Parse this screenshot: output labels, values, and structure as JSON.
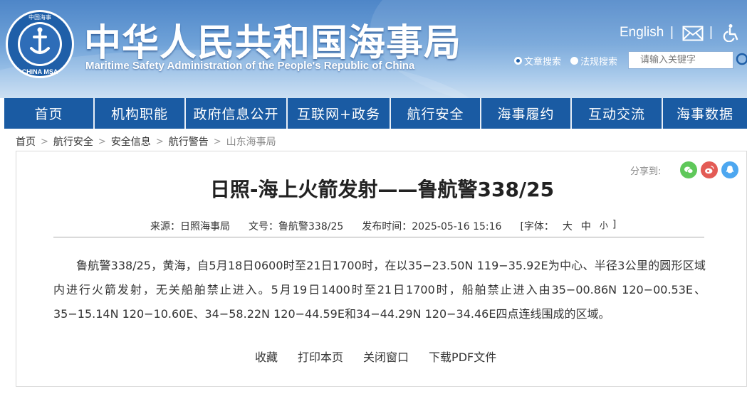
{
  "header": {
    "logo_text": "CHINA MSA",
    "logo_ring_text": "中国海事",
    "title_cn": "中华人民共和国海事局",
    "title_en": "Maritime Safety Administration of the People's Republic of China",
    "english_link": "English",
    "separator": "|",
    "mail_icon": "mail-icon",
    "accessibility_icon": "accessibility-icon",
    "search": {
      "option_article": "文章搜索",
      "option_law": "法规搜索",
      "selected": "文章搜索",
      "placeholder": "请输入关键字",
      "icon": "search-icon"
    }
  },
  "nav": {
    "items": [
      "首页",
      "机构职能",
      "政府信息公开",
      "互联网+政务",
      "航行安全",
      "海事履约",
      "互动交流",
      "海事数据"
    ]
  },
  "breadcrumb": {
    "separator": ">",
    "items": [
      "首页",
      "航行安全",
      "安全信息",
      "航行警告",
      "山东海事局"
    ]
  },
  "article": {
    "share_label": "分享到:",
    "share_icons": [
      "wechat-icon",
      "weibo-icon",
      "qq-icon"
    ],
    "title": "日照-海上火箭发射——鲁航警338/25",
    "meta": {
      "source": "来源：日照海事局",
      "doc_no": "文号：鲁航警338/25",
      "publish_time": "发布时间：2025-05-16 15:16",
      "font_size_label": "[字体：",
      "font_large": "大",
      "font_medium": "中",
      "font_small": "小",
      "font_close": "]"
    },
    "body": "鲁航警338/25，黄海，自5月18日0600时至21日1700时，在以35−23.50N 119−35.92E为中心、半径3公里的圆形区域内进行火箭发射，无关船舶禁止进入。5月19日1400时至21日1700时，船舶禁止进入由35−00.86N 120−00.53E、35−15.14N 120−10.60E、34−58.22N 120−44.59E和34−44.29N 120−34.46E四点连线围成的区域。",
    "actions": [
      "收藏",
      "打印本页",
      "关闭窗口",
      "下载PDF文件"
    ]
  },
  "colors": {
    "nav_bg": "#1a5ba3",
    "header_top": "#4e86c8",
    "wechat": "#5fc85a",
    "weibo": "#e35b55",
    "qq": "#4da7f0"
  }
}
